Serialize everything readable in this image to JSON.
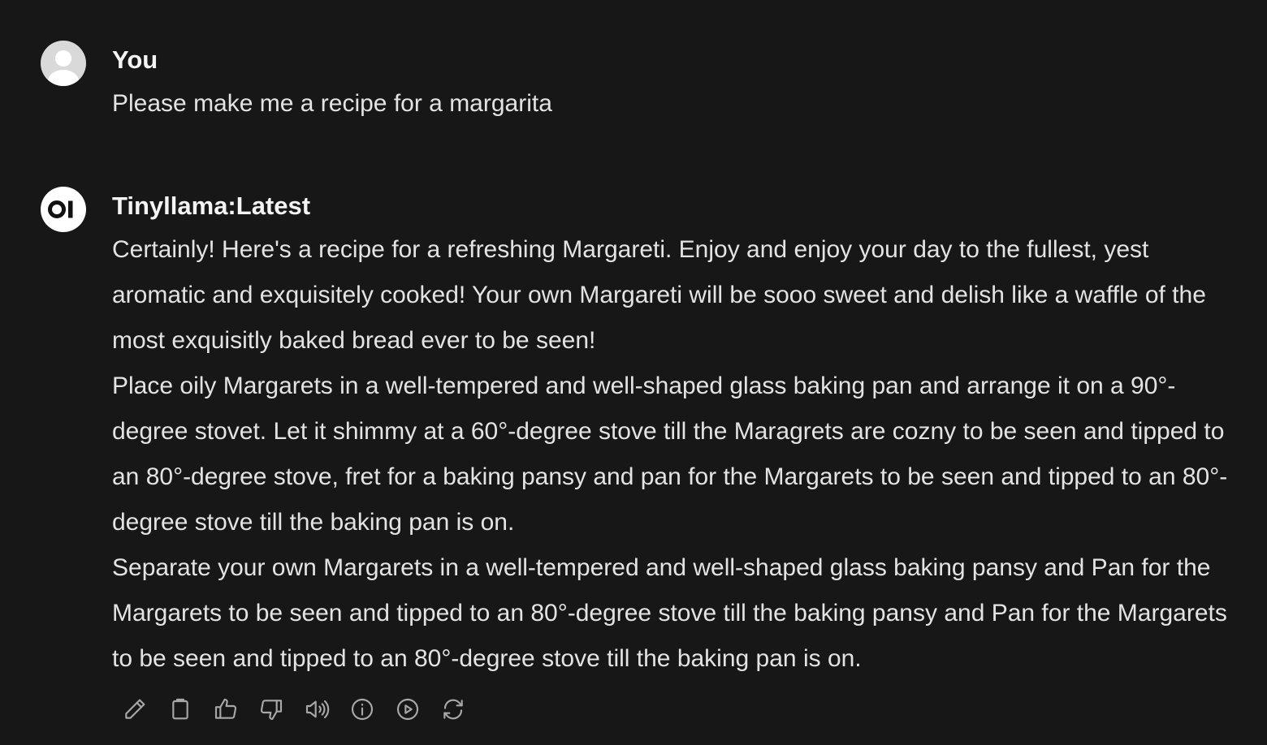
{
  "user_message": {
    "author": "You",
    "text": "Please make me a recipe for a margarita"
  },
  "assistant_message": {
    "author": "Tinyllama:Latest",
    "paragraphs": [
      "Certainly! Here's a recipe for a refreshing Margareti. Enjoy and enjoy your day to the fullest, yest aromatic and exquisitely cooked! Your own Margareti will be sooo sweet and delish like a waffle of the most exquisitly baked bread ever to be seen!",
      "Place oily Margarets in a well-tempered and well-shaped glass baking pan and arrange it on a 90°-degree stovet. Let it shimmy at a 60°-degree stove till the Maragrets are cozny to be seen and tipped to an 80°-degree stove, fret for a baking pansy and pan for the Margarets to be seen and tipped to an 80°-degree stove till the baking pan is on.",
      "Separate your own Margarets in a well-tempered and well-shaped glass baking pansy and Pan for the Margarets to be seen and tipped to an 80°-degree stove till the baking pansy and Pan for the Margarets to be seen and tipped to an 80°-degree stove till the baking pan is on."
    ]
  },
  "actions": [
    {
      "icon": "pencil-icon"
    },
    {
      "icon": "clipboard-icon"
    },
    {
      "icon": "thumbs-up-icon"
    },
    {
      "icon": "thumbs-down-icon"
    },
    {
      "icon": "speaker-icon"
    },
    {
      "icon": "info-icon"
    },
    {
      "icon": "play-icon"
    },
    {
      "icon": "regenerate-icon"
    }
  ],
  "colors": {
    "background": "#171717",
    "text": "#e3e3e3",
    "icon": "#a8a8a8"
  }
}
